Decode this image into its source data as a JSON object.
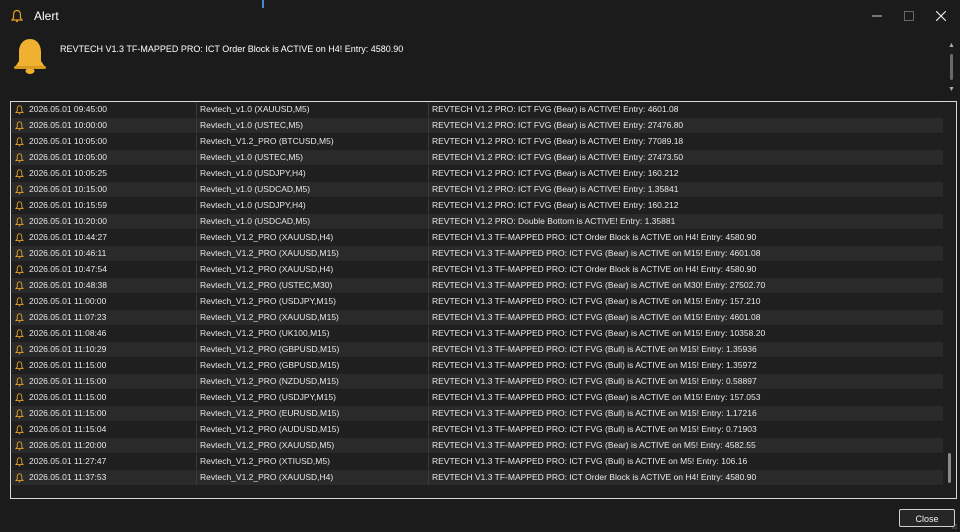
{
  "window": {
    "title": "Alert"
  },
  "message": {
    "text": "REVTECH V1.3 TF-MAPPED PRO: ICT Order Block is ACTIVE on H4! Entry: 4580.90"
  },
  "alerts": [
    {
      "time": "2026.05.01 09:45:00",
      "symbol": "Revtech_v1.0 (XAUUSD,M5)",
      "message": "REVTECH V1.2 PRO: ICT FVG (Bear) is ACTIVE! Entry: 4601.08"
    },
    {
      "time": "2026.05.01 10:00:00",
      "symbol": "Revtech_v1.0 (USTEC,M5)",
      "message": "REVTECH V1.2 PRO: ICT FVG (Bear) is ACTIVE! Entry: 27476.80"
    },
    {
      "time": "2026.05.01 10:05:00",
      "symbol": "Revtech_V1.2_PRO (BTCUSD,M5)",
      "message": "REVTECH V1.2 PRO: ICT FVG (Bear) is ACTIVE! Entry: 77089.18"
    },
    {
      "time": "2026.05.01 10:05:00",
      "symbol": "Revtech_v1.0 (USTEC,M5)",
      "message": "REVTECH V1.2 PRO: ICT FVG (Bear) is ACTIVE! Entry: 27473.50"
    },
    {
      "time": "2026.05.01 10:05:25",
      "symbol": "Revtech_v1.0 (USDJPY,H4)",
      "message": "REVTECH V1.2 PRO: ICT FVG (Bear) is ACTIVE! Entry: 160.212"
    },
    {
      "time": "2026.05.01 10:15:00",
      "symbol": "Revtech_v1.0 (USDCAD,M5)",
      "message": "REVTECH V1.2 PRO: ICT FVG (Bear) is ACTIVE! Entry: 1.35841"
    },
    {
      "time": "2026.05.01 10:15:59",
      "symbol": "Revtech_v1.0 (USDJPY,H4)",
      "message": "REVTECH V1.2 PRO: ICT FVG (Bear) is ACTIVE! Entry: 160.212"
    },
    {
      "time": "2026.05.01 10:20:00",
      "symbol": "Revtech_v1.0 (USDCAD,M5)",
      "message": "REVTECH V1.2 PRO: Double Bottom is ACTIVE! Entry: 1.35881"
    },
    {
      "time": "2026.05.01 10:44:27",
      "symbol": "Revtech_V1.2_PRO (XAUUSD,H4)",
      "message": "REVTECH V1.3 TF-MAPPED PRO: ICT Order Block is ACTIVE on H4! Entry: 4580.90"
    },
    {
      "time": "2026.05.01 10:46:11",
      "symbol": "Revtech_V1.2_PRO (XAUUSD,M15)",
      "message": "REVTECH V1.3 TF-MAPPED PRO: ICT FVG (Bear) is ACTIVE on M15! Entry: 4601.08"
    },
    {
      "time": "2026.05.01 10:47:54",
      "symbol": "Revtech_V1.2_PRO (XAUUSD,H4)",
      "message": "REVTECH V1.3 TF-MAPPED PRO: ICT Order Block is ACTIVE on H4! Entry: 4580.90"
    },
    {
      "time": "2026.05.01 10:48:38",
      "symbol": "Revtech_V1.2_PRO (USTEC,M30)",
      "message": "REVTECH V1.3 TF-MAPPED PRO: ICT FVG (Bear) is ACTIVE on M30! Entry: 27502.70"
    },
    {
      "time": "2026.05.01 11:00:00",
      "symbol": "Revtech_V1.2_PRO (USDJPY,M15)",
      "message": "REVTECH V1.3 TF-MAPPED PRO: ICT FVG (Bear) is ACTIVE on M15! Entry: 157.210"
    },
    {
      "time": "2026.05.01 11:07:23",
      "symbol": "Revtech_V1.2_PRO (XAUUSD,M15)",
      "message": "REVTECH V1.3 TF-MAPPED PRO: ICT FVG (Bear) is ACTIVE on M15! Entry: 4601.08"
    },
    {
      "time": "2026.05.01 11:08:46",
      "symbol": "Revtech_V1.2_PRO (UK100,M15)",
      "message": "REVTECH V1.3 TF-MAPPED PRO: ICT FVG (Bear) is ACTIVE on M15! Entry: 10358.20"
    },
    {
      "time": "2026.05.01 11:10:29",
      "symbol": "Revtech_V1.2_PRO (GBPUSD,M15)",
      "message": "REVTECH V1.3 TF-MAPPED PRO: ICT FVG (Bull) is ACTIVE on M15! Entry: 1.35936"
    },
    {
      "time": "2026.05.01 11:15:00",
      "symbol": "Revtech_V1.2_PRO (GBPUSD,M15)",
      "message": "REVTECH V1.3 TF-MAPPED PRO: ICT FVG (Bull) is ACTIVE on M15! Entry: 1.35972"
    },
    {
      "time": "2026.05.01 11:15:00",
      "symbol": "Revtech_V1.2_PRO (NZDUSD,M15)",
      "message": "REVTECH V1.3 TF-MAPPED PRO: ICT FVG (Bull) is ACTIVE on M15! Entry: 0.58897"
    },
    {
      "time": "2026.05.01 11:15:00",
      "symbol": "Revtech_V1.2_PRO (USDJPY,M15)",
      "message": "REVTECH V1.3 TF-MAPPED PRO: ICT FVG (Bear) is ACTIVE on M15! Entry: 157.053"
    },
    {
      "time": "2026.05.01 11:15:00",
      "symbol": "Revtech_V1.2_PRO (EURUSD,M15)",
      "message": "REVTECH V1.3 TF-MAPPED PRO: ICT FVG (Bull) is ACTIVE on M15! Entry: 1.17216"
    },
    {
      "time": "2026.05.01 11:15:04",
      "symbol": "Revtech_V1.2_PRO (AUDUSD,M15)",
      "message": "REVTECH V1.3 TF-MAPPED PRO: ICT FVG (Bull) is ACTIVE on M15! Entry: 0.71903"
    },
    {
      "time": "2026.05.01 11:20:00",
      "symbol": "Revtech_V1.2_PRO (XAUUSD,M5)",
      "message": "REVTECH V1.3 TF-MAPPED PRO: ICT FVG (Bear) is ACTIVE on M5! Entry: 4582.55"
    },
    {
      "time": "2026.05.01 11:27:47",
      "symbol": "Revtech_V1.2_PRO (XTIUSD,M5)",
      "message": "REVTECH V1.3 TF-MAPPED PRO: ICT FVG (Bull) is ACTIVE on M5! Entry: 106.16"
    },
    {
      "time": "2026.05.01 11:37:53",
      "symbol": "Revtech_V1.2_PRO (XAUUSD,H4)",
      "message": "REVTECH V1.3 TF-MAPPED PRO: ICT Order Block is ACTIVE on H4! Entry: 4580.90"
    }
  ],
  "buttons": {
    "close_label": "Close"
  },
  "icons": {
    "window": "bell-icon",
    "alert": "bell-icon",
    "row": "bell-icon"
  },
  "colors": {
    "bell": "#f0b030",
    "bell_outline": "#e8a020",
    "background": "#1b1b1b"
  }
}
